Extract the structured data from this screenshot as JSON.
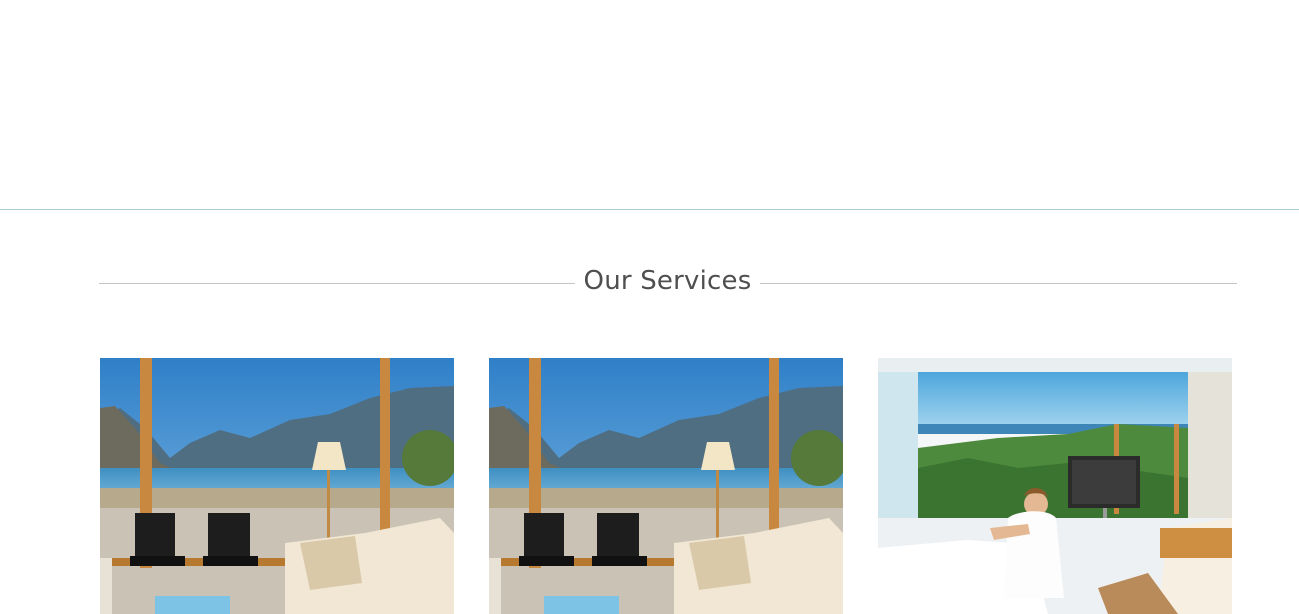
{
  "section": {
    "title": "Our Services"
  },
  "services": [
    {
      "image": "living-room-lake-view"
    },
    {
      "image": "living-room-lake-view"
    },
    {
      "image": "woman-on-sofa-sea-view"
    }
  ],
  "colors": {
    "divider": "#a9cfd8",
    "heading_text": "#4f4f4f",
    "heading_rule": "#c4c4c4"
  }
}
